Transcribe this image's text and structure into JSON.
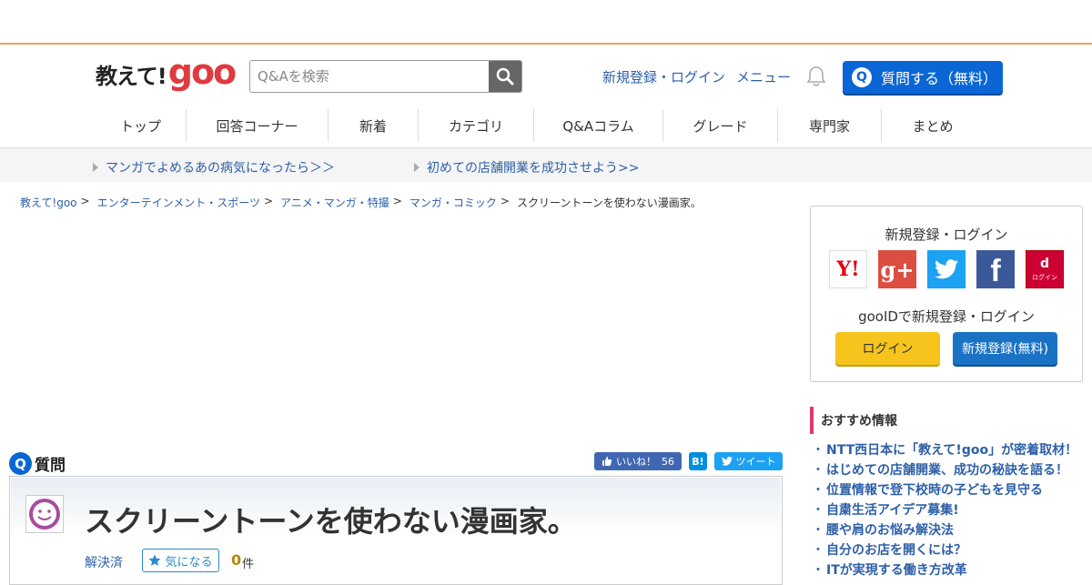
{
  "header": {
    "logo_text": "教えて!",
    "logo_goo": "goo",
    "search_placeholder": "Q&Aを検索",
    "register_login": "新規登録・ログイン",
    "menu": "メニュー",
    "ask_q": "Q",
    "ask_label": "質問する（無料）"
  },
  "nav": [
    "トップ",
    "回答コーナー",
    "新着",
    "カテゴリ",
    "Q&Aコラム",
    "グレード",
    "専門家",
    "まとめ"
  ],
  "promo": [
    "マンガでよめるあの病気になったら＞＞",
    "初めての店舗開業を成功させよう>>"
  ],
  "breadcrumb": {
    "items": [
      "教えて!goo",
      "エンターテインメント・スポーツ",
      "アニメ・マンガ・特撮",
      "マンガ・コミック"
    ],
    "current": "スクリーントーンを使わない漫画家。",
    "separator": ">"
  },
  "question": {
    "q_icon": "Q",
    "section_label": "質問",
    "title": "スクリーントーンを使わない漫画家。",
    "status": "解決済",
    "kininaru_label": "気になる",
    "count": "0",
    "count_unit": "件"
  },
  "share": {
    "like_label": "いいね！",
    "like_count": "56",
    "hatena_label": "B!",
    "tweet_label": "ツイート"
  },
  "sidebar": {
    "login_title": "新規登録・ログイン",
    "sns": [
      {
        "name": "yahoo",
        "label": "Y!",
        "color": "#ffffff"
      },
      {
        "name": "google-plus",
        "label": "g+",
        "color": "#dc4e41"
      },
      {
        "name": "twitter",
        "label": "",
        "color": "#1da1f2"
      },
      {
        "name": "facebook",
        "label": "f",
        "color": "#3b5998"
      },
      {
        "name": "docomo",
        "label": "d",
        "color": "#cc0033"
      }
    ],
    "docomo_sub": "ログイン",
    "gooid_text": "gooIDで新規登録・ログイン",
    "login_btn": "ログイン",
    "register_btn": "新規登録(無料)",
    "recommend_title": "おすすめ情報",
    "recommend_items": [
      "NTT西日本に「教えて!goo」が密着取材！",
      "はじめての店舗開業、成功の秘訣を語る！",
      "位置情報で登下校時の子どもを見守る",
      "自粛生活アイデア募集!",
      "腰や肩のお悩み解決法",
      "自分のお店を開くには？",
      "ITが実現する働き方改革"
    ]
  },
  "colors": {
    "accent": "#0a66d4",
    "link": "#2d5fa8",
    "logo_red": "#e03a3e",
    "orange_line": "#f4a261"
  }
}
